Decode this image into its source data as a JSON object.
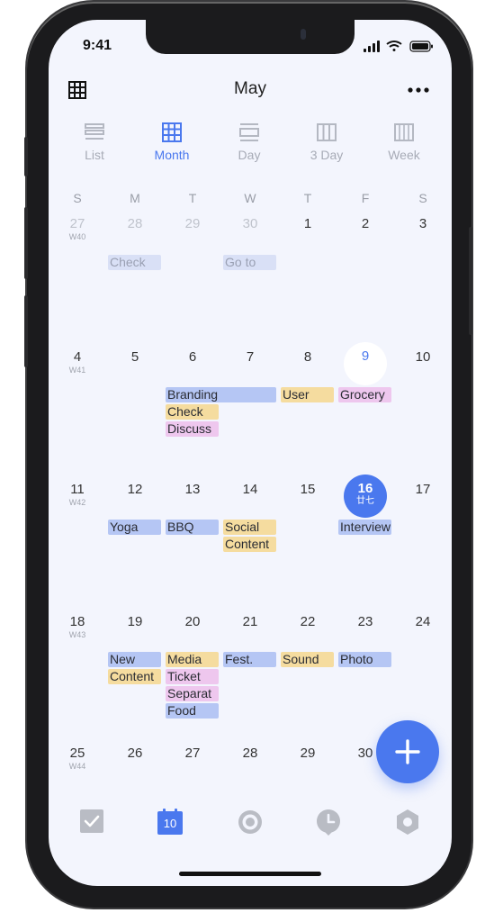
{
  "status": {
    "time": "9:41"
  },
  "header": {
    "title": "May"
  },
  "view_tabs": [
    {
      "label": "List"
    },
    {
      "label": "Month"
    },
    {
      "label": "Day"
    },
    {
      "label": "3 Day"
    },
    {
      "label": "Week"
    }
  ],
  "weekdays": [
    "S",
    "M",
    "T",
    "W",
    "T",
    "F",
    "S"
  ],
  "weeks": [
    {
      "num": "W40",
      "days": [
        "27",
        "28",
        "29",
        "30",
        "1",
        "2",
        "3"
      ]
    },
    {
      "num": "W41",
      "days": [
        "4",
        "5",
        "6",
        "7",
        "8",
        "9",
        "10"
      ]
    },
    {
      "num": "W42",
      "days": [
        "11",
        "12",
        "13",
        "14",
        "15",
        "16",
        "17"
      ]
    },
    {
      "num": "W43",
      "days": [
        "18",
        "19",
        "20",
        "21",
        "22",
        "23",
        "24"
      ]
    },
    {
      "num": "W44",
      "days": [
        "25",
        "26",
        "27",
        "28",
        "29",
        "30",
        ""
      ]
    }
  ],
  "selected_day_sub": "廿七",
  "events": {
    "check_faded": "Check",
    "goto_faded": "Go to",
    "branding": "Branding",
    "user": "User",
    "grocery": "Grocery",
    "check": "Check",
    "discuss": "Discuss",
    "yoga": "Yoga",
    "bbq": "BBQ",
    "social": "Social",
    "content": "Content",
    "interview": "Interview",
    "new": "New",
    "content2": "Content",
    "media": "Media",
    "ticket": "Ticket",
    "separat": "Separat",
    "food": "Food",
    "fest": "Fest.",
    "sound": "Sound",
    "photo": "Photo"
  },
  "bottom_nav": {
    "calendar_date": "10"
  },
  "colors": {
    "accent": "#4a78ee",
    "blue_event": "#b5c6f4",
    "yellow_event": "#f5dc9f",
    "pink_event": "#eec7ee"
  }
}
